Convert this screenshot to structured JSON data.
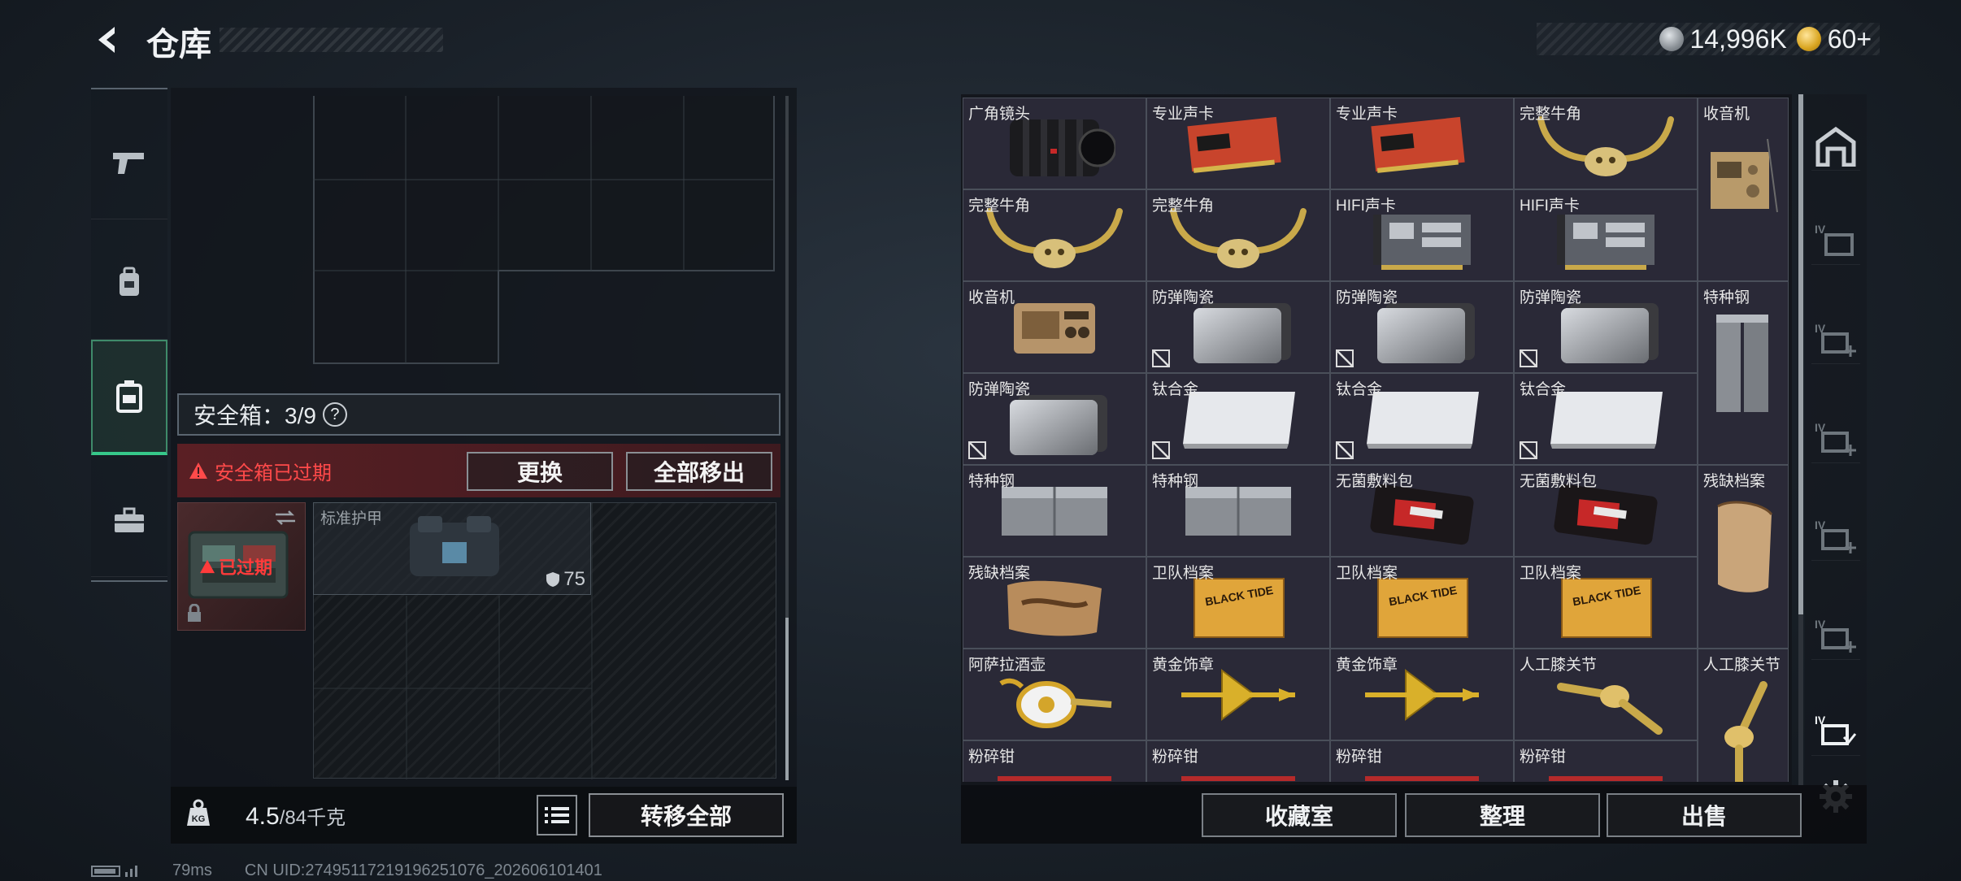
{
  "header": {
    "title": "仓库",
    "currency_primary": "14,996K",
    "currency_secondary": "60+",
    "primary_coin_color": "#9aa0a6",
    "secondary_coin_color": "#d9a520"
  },
  "left_nav": {
    "items": [
      {
        "icon": "pistol-icon"
      },
      {
        "icon": "backpack-icon"
      },
      {
        "icon": "safe-case-icon",
        "active": true
      },
      {
        "icon": "toolbox-icon"
      }
    ]
  },
  "safe_box": {
    "label": "安全箱：3/9",
    "help": "?",
    "warning": "安全箱已过期",
    "replace_label": "更换",
    "remove_all_label": "全部移出",
    "expired_tag": "已过期",
    "armor_slot_label": "标准护甲",
    "armor_value": "75"
  },
  "bottom_left": {
    "weight": "4.5",
    "weight_max": "/84千克",
    "transfer_label": "转移全部"
  },
  "inventory": {
    "items": [
      {
        "label": "广角镜头",
        "art": "lens"
      },
      {
        "label": "专业声卡",
        "art": "card"
      },
      {
        "label": "专业声卡",
        "art": "card"
      },
      {
        "label": "完整牛角",
        "art": "horn"
      },
      {
        "label": "收音机",
        "art": "radio-tall"
      },
      {
        "label": "完整牛角",
        "art": "horn"
      },
      {
        "label": "完整牛角",
        "art": "horn"
      },
      {
        "label": "HIFI声卡",
        "art": "hifi"
      },
      {
        "label": "HIFI声卡",
        "art": "hifi"
      },
      {
        "label": "收音机",
        "art": "radio"
      },
      {
        "label": "防弹陶瓷",
        "art": "ceramic"
      },
      {
        "label": "防弹陶瓷",
        "art": "ceramic"
      },
      {
        "label": "防弹陶瓷",
        "art": "ceramic"
      },
      {
        "label": "特种钢",
        "art": "steel-tall"
      },
      {
        "label": "防弹陶瓷",
        "art": "ceramic"
      },
      {
        "label": "钛合金",
        "art": "titanium"
      },
      {
        "label": "钛合金",
        "art": "titanium"
      },
      {
        "label": "钛合金",
        "art": "titanium"
      },
      {
        "label": "特种钢",
        "art": "steel"
      },
      {
        "label": "特种钢",
        "art": "steel"
      },
      {
        "label": "无菌敷料包",
        "art": "bandage"
      },
      {
        "label": "无菌敷料包",
        "art": "bandage"
      },
      {
        "label": "残缺档案",
        "art": "scroll-tall"
      },
      {
        "label": "残缺档案",
        "art": "scroll"
      },
      {
        "label": "卫队档案",
        "art": "folder"
      },
      {
        "label": "卫队档案",
        "art": "folder"
      },
      {
        "label": "卫队档案",
        "art": "folder"
      },
      {
        "label": "阿萨拉酒壶",
        "art": "jug"
      },
      {
        "label": "黄金饰章",
        "art": "gold"
      },
      {
        "label": "黄金饰章",
        "art": "gold"
      },
      {
        "label": "人工膝关节",
        "art": "knee"
      },
      {
        "label": "人工膝关节",
        "art": "knee-tall"
      },
      {
        "label": "粉碎钳",
        "art": "pliers"
      },
      {
        "label": "粉碎钳",
        "art": "pliers"
      },
      {
        "label": "粉碎钳",
        "art": "pliers"
      },
      {
        "label": "粉碎钳",
        "art": "pliers"
      }
    ]
  },
  "bottom_right": {
    "collection_label": "收藏室",
    "sort_label": "整理",
    "sell_label": "出售"
  },
  "footer": {
    "ping": "79ms",
    "uid": "CN UID:27495117219196251076_202606101401"
  }
}
